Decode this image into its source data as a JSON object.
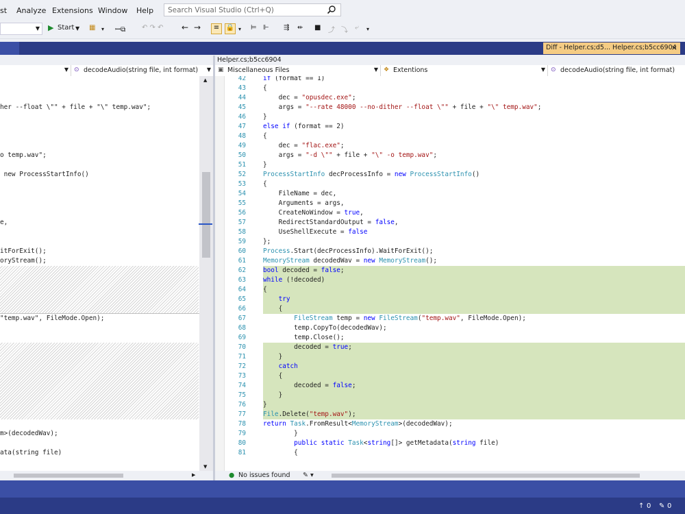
{
  "menu": {
    "items": [
      "st",
      "Analyze",
      "Extensions",
      "Window",
      "Help"
    ]
  },
  "search": {
    "placeholder": "Search Visual Studio (Ctrl+Q)"
  },
  "toolbar": {
    "start_label": "Start"
  },
  "diff_tab": {
    "title": "Diff - Helper.cs;d5... Helper.cs;b5cc6904"
  },
  "right_file_header": "Helper.cs;b5cc6904",
  "left_nav": {
    "member": "decodeAudio(string file, int format)"
  },
  "right_nav": {
    "project": "Miscellaneous Files",
    "class": "Extentions",
    "member": "decodeAudio(string file, int format)"
  },
  "left_code": [
    "her --float \\\"\" + file + \"\\\" temp.wav\";",
    "o temp.wav\";",
    " new ProcessStartInfo()",
    "e,",
    "itForExit();",
    "oryStream();",
    "\"temp.wav\", FileMode.Open);",
    "m>(decodedWav);",
    "ata(string file)"
  ],
  "right_code": [
    {
      "n": "42",
      "t": "            if (format == 1)"
    },
    {
      "n": "43",
      "t": "            {"
    },
    {
      "n": "44",
      "t": "                dec = \"opusdec.exe\";"
    },
    {
      "n": "45",
      "t": "                args = \"--rate 48000 --no-dither --float \\\"\" + file + \"\\\" temp.wav\";"
    },
    {
      "n": "46",
      "t": "            }"
    },
    {
      "n": "47",
      "t": "            else if (format == 2)"
    },
    {
      "n": "48",
      "t": "            {"
    },
    {
      "n": "49",
      "t": "                dec = \"flac.exe\";"
    },
    {
      "n": "50",
      "t": "                args = \"-d \\\"\" + file + \"\\\" -o temp.wav\";"
    },
    {
      "n": "51",
      "t": "            }"
    },
    {
      "n": "52",
      "t": "            ProcessStartInfo decProcessInfo = new ProcessStartInfo()"
    },
    {
      "n": "53",
      "t": "            {"
    },
    {
      "n": "54",
      "t": "                FileName = dec,"
    },
    {
      "n": "55",
      "t": "                Arguments = args,"
    },
    {
      "n": "56",
      "t": "                CreateNoWindow = true,"
    },
    {
      "n": "57",
      "t": "                RedirectStandardOutput = false,"
    },
    {
      "n": "58",
      "t": "                UseShellExecute = false"
    },
    {
      "n": "59",
      "t": "            };"
    },
    {
      "n": "60",
      "t": "            Process.Start(decProcessInfo).WaitForExit();"
    },
    {
      "n": "61",
      "t": "            MemoryStream decodedWav = new MemoryStream();"
    },
    {
      "n": "62",
      "t": "            bool decoded = false;"
    },
    {
      "n": "63",
      "t": "            while (!decoded)"
    },
    {
      "n": "64",
      "t": "            {"
    },
    {
      "n": "65",
      "t": "                try"
    },
    {
      "n": "66",
      "t": "                {"
    },
    {
      "n": "67",
      "t": "                    FileStream temp = new FileStream(\"temp.wav\", FileMode.Open);"
    },
    {
      "n": "68",
      "t": "                    temp.CopyTo(decodedWav);"
    },
    {
      "n": "69",
      "t": "                    temp.Close();"
    },
    {
      "n": "70",
      "t": "                    decoded = true;"
    },
    {
      "n": "71",
      "t": "                }"
    },
    {
      "n": "72",
      "t": "                catch"
    },
    {
      "n": "73",
      "t": "                {"
    },
    {
      "n": "74",
      "t": "                    decoded = false;"
    },
    {
      "n": "75",
      "t": "                }"
    },
    {
      "n": "76",
      "t": "            }"
    },
    {
      "n": "77",
      "t": "            File.Delete(\"temp.wav\");"
    },
    {
      "n": "78",
      "t": "            return Task.FromResult<MemoryStream>(decodedWav);"
    },
    {
      "n": "79",
      "t": "        }"
    },
    {
      "n": "80",
      "t": "        public static Task<string[]> getMetadata(string file)"
    },
    {
      "n": "81",
      "t": "        {"
    }
  ],
  "status": {
    "issues": "No issues found"
  },
  "bottom": {
    "up_count": "0",
    "pencil_count": "0"
  },
  "colors": {
    "accent": "#2b3b86",
    "diff_added": "#d6e5bd",
    "tab_highlight": "#f5cc84"
  }
}
